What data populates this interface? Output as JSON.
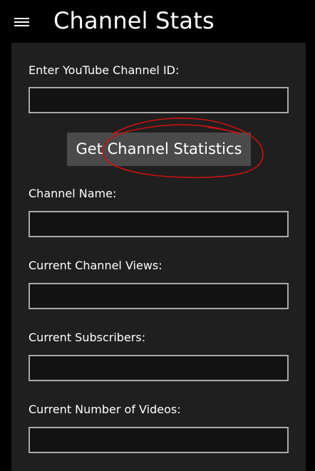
{
  "header": {
    "title": "Channel Stats",
    "menu_icon": "hamburger-menu-icon"
  },
  "form": {
    "channel_id_label": "Enter YouTube Channel ID:",
    "channel_id_value": "",
    "button_label": "Get Channel Statistics",
    "channel_name_label": "Channel Name:",
    "channel_name_value": "",
    "views_label": "Current Channel Views:",
    "views_value": "",
    "subscribers_label": "Current Subscribers:",
    "subscribers_value": "",
    "videos_label": "Current Number of Videos:",
    "videos_value": ""
  },
  "annotation": {
    "color": "#cc1111",
    "shape": "hand-drawn-circle"
  },
  "colors": {
    "background": "#000000",
    "panel": "#1f1f1f",
    "button": "#4a4a4a",
    "input_border": "#a8a8a8"
  }
}
